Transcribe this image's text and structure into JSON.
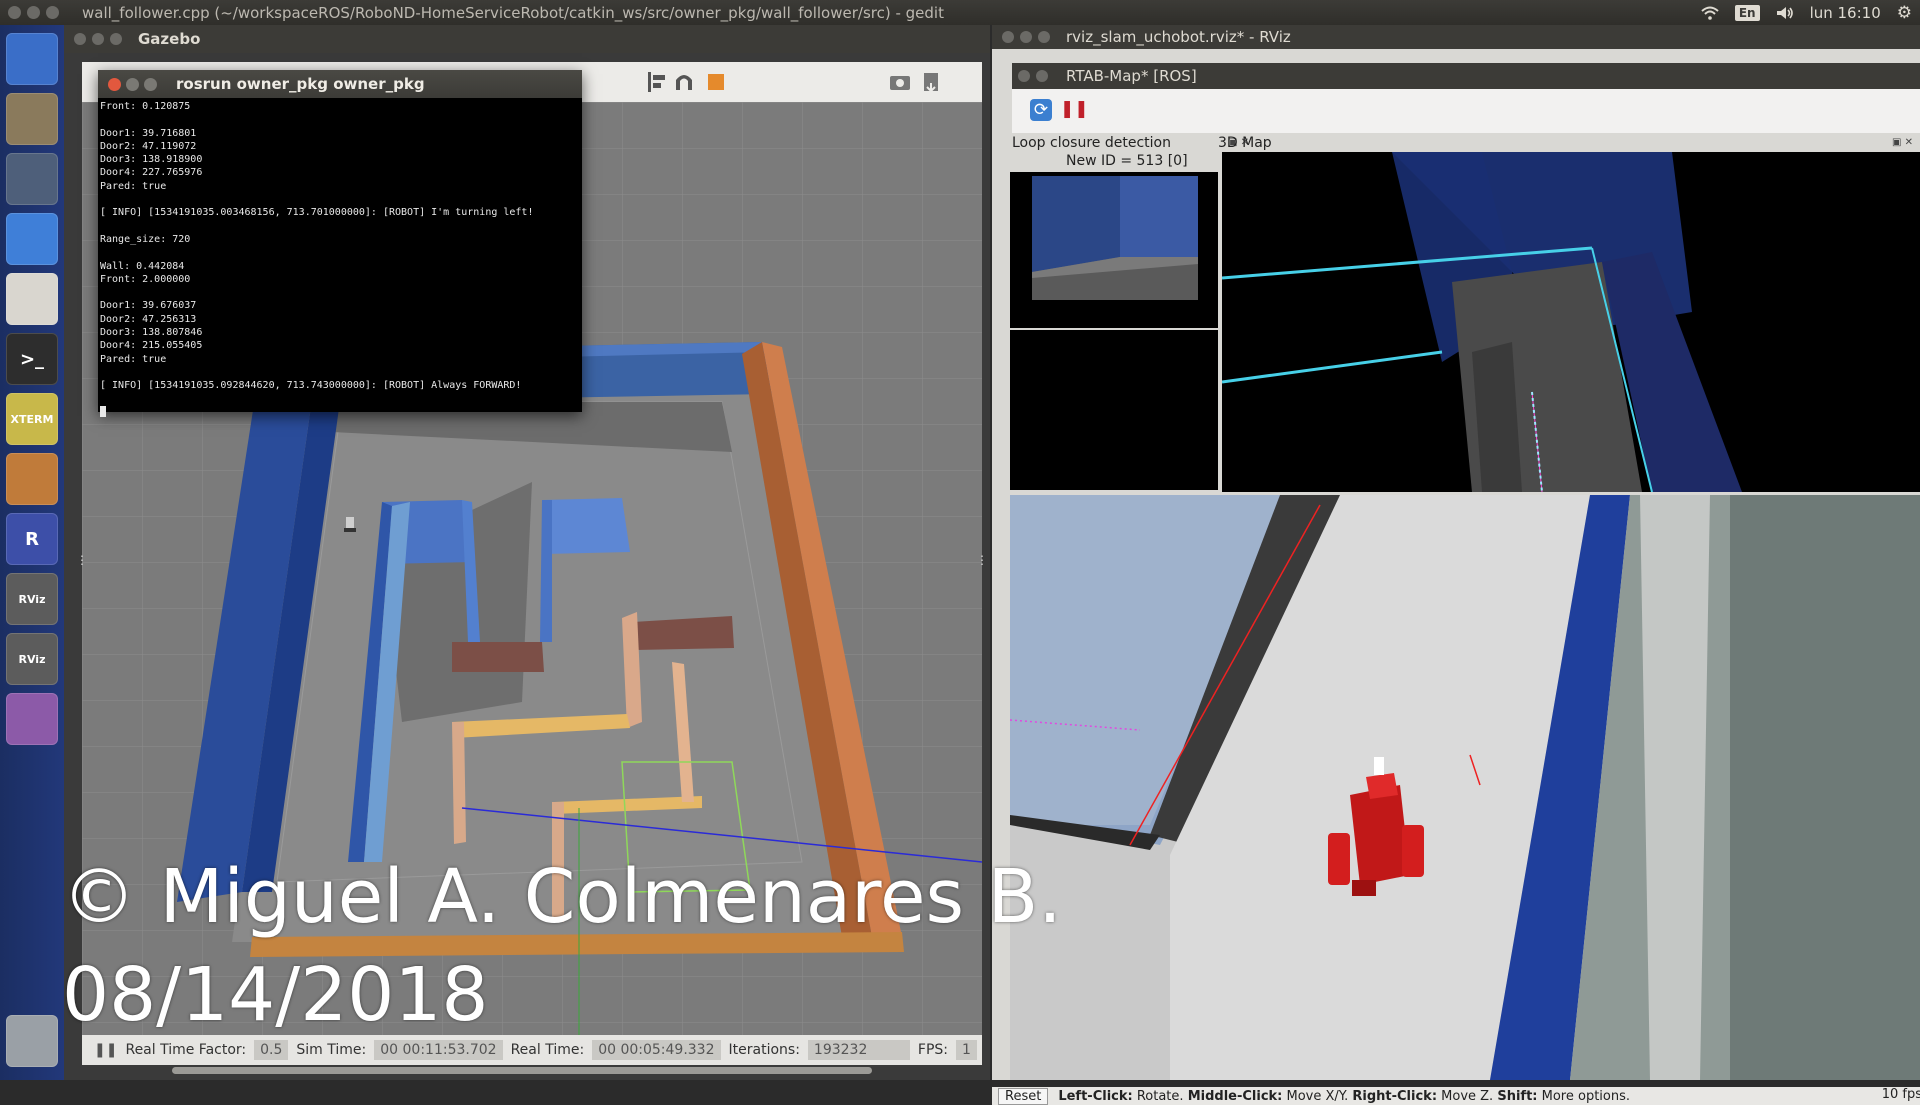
{
  "top_panel": {
    "window_title": "wall_follower.cpp (~/workspaceROS/RoboND-HomeServiceRobot/catkin_ws/src/owner_pkg/wall_follower/src) - gedit",
    "keyboard_layout": "En",
    "clock": "lun 16:10",
    "icons": [
      "wifi-icon",
      "volume-icon",
      "settings-gear-icon"
    ]
  },
  "launcher": {
    "items": [
      {
        "name": "ubuntu-dash",
        "label": "",
        "color": "#3a6ec8"
      },
      {
        "name": "files",
        "label": "",
        "color": "#8a7a5c"
      },
      {
        "name": "system-settings",
        "label": "",
        "color": "#4e5f7a"
      },
      {
        "name": "chromium",
        "label": "",
        "color": "#3f7fd8"
      },
      {
        "name": "text-editor",
        "label": "",
        "color": "#d9d6cf"
      },
      {
        "name": "terminal",
        "label": ">_",
        "color": "#2d2d2d"
      },
      {
        "name": "xterm",
        "label": "XTERM",
        "color": "#c8b84a"
      },
      {
        "name": "virtualbox",
        "label": "",
        "color": "#c07b3a"
      },
      {
        "name": "rqt",
        "label": "R",
        "color": "#3d4fa8"
      },
      {
        "name": "rviz-1",
        "label": "RViz",
        "color": "#5c5c5c"
      },
      {
        "name": "rviz-2",
        "label": "RViz",
        "color": "#5c5c5c"
      },
      {
        "name": "workspace-switcher",
        "label": "",
        "color": "#8c5aa8"
      },
      {
        "name": "trash",
        "label": "",
        "color": "#9aa0a6"
      }
    ]
  },
  "gazebo": {
    "window_title": "Gazebo",
    "status": {
      "real_time_factor_label": "Real Time Factor:",
      "real_time_factor_value": "0.5",
      "sim_time_label": "Sim Time:",
      "sim_time_value": "00 00:11:53.702",
      "real_time_label": "Real Time:",
      "real_time_value": "00 00:05:49.332",
      "iterations_label": "Iterations:",
      "iterations_value": "193232",
      "fps_label": "FPS:",
      "fps_value": "1"
    }
  },
  "terminal": {
    "title": "rosrun owner_pkg owner_pkg",
    "lines": [
      "Front: 0.120875",
      "",
      "Door1: 39.716801",
      "Door2: 47.119072",
      "Door3: 138.918900",
      "Door4: 227.765976",
      "Pared: true",
      "",
      "[ INFO] [1534191035.003468156, 713.701000000]: [ROBOT] I'm turning left!",
      "",
      "Range_size: 720",
      "",
      "Wall: 0.442084",
      "Front: 2.000000",
      "",
      "Door1: 39.676037",
      "Door2: 47.256313",
      "Door3: 138.807846",
      "Door4: 215.055405",
      "Pared: true",
      "",
      "[ INFO] [1534191035.092844620, 713.743000000]: [ROBOT] Always FORWARD!",
      ""
    ]
  },
  "rviz": {
    "window_title": "rviz_slam_uchobot.rviz* - RViz",
    "rtabmap_title": "RTAB-Map* [ROS]",
    "loop_closure_label": "Loop closure detection",
    "new_id_label": "New ID = 513 [0]",
    "map3d_label": "3D Map",
    "bottom": {
      "reset_label": "Reset",
      "hint_left_key": "Left-Click:",
      "hint_left_val": "Rotate.",
      "hint_middle_key": "Middle-Click:",
      "hint_middle_val": "Move X/Y.",
      "hint_right_key": "Right-Click:",
      "hint_right_val": "Move Z.",
      "hint_shift_key": "Shift:",
      "hint_shift_val": "More options.",
      "fps": "10 fps"
    }
  },
  "watermark": {
    "line1": "© Miguel A. Colmenares B.",
    "line2": "08/14/2018"
  }
}
